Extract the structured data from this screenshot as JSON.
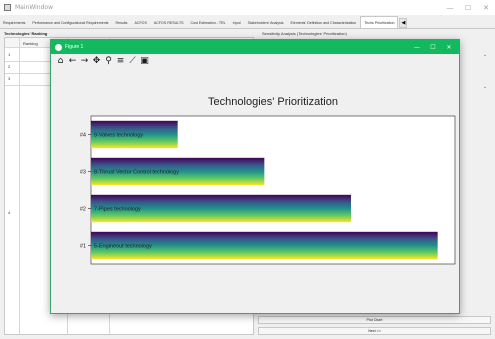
{
  "window": {
    "title": "MainWindow",
    "minimize": "—",
    "maximize": "☐",
    "close": "✕"
  },
  "tabs": [
    {
      "label": "Requirements",
      "active": false
    },
    {
      "label": "Performance and Configurational Requirements",
      "active": false
    },
    {
      "label": "Results",
      "active": false
    },
    {
      "label": "ACFOS",
      "active": false
    },
    {
      "label": "ACFOS RESULTS",
      "active": false
    },
    {
      "label": "Cost Estimation - TRL",
      "active": false
    },
    {
      "label": "Input",
      "active": false
    },
    {
      "label": "Stakeholders' Analysis",
      "active": false
    },
    {
      "label": "Elements' Definition and Characterization",
      "active": false
    },
    {
      "label": "Techs Prioritization",
      "active": true
    }
  ],
  "tab_scroll": "◀",
  "left_panel": {
    "label": "Technologies' Ranking",
    "column_header": "Ranking",
    "rows": [
      "1",
      "2",
      "3",
      "4"
    ]
  },
  "right_panel": {
    "label": "Sensitivity Analysis (Technologies' Prioritization)",
    "combo_arrow": "⌄",
    "plot_chart_button": "Plot Chart",
    "next_button": "Next >>"
  },
  "figure": {
    "title": "Figure 1",
    "minimize": "—",
    "maximize": "☐",
    "close": "✕",
    "toolbar": [
      {
        "name": "home-icon",
        "glyph": "⌂"
      },
      {
        "name": "back-arrow-icon",
        "glyph": "←"
      },
      {
        "name": "forward-arrow-icon",
        "glyph": "→"
      },
      {
        "name": "pan-icon",
        "glyph": "✥"
      },
      {
        "name": "zoom-icon",
        "glyph": "⚲"
      },
      {
        "name": "configure-subplots-icon",
        "glyph": "≡"
      },
      {
        "name": "edit-axis-icon",
        "glyph": "⟋"
      },
      {
        "name": "save-icon",
        "glyph": "▣"
      }
    ]
  },
  "chart_data": {
    "type": "bar",
    "orientation": "horizontal",
    "title": "Technologies' Prioritization",
    "categories": [
      "#1",
      "#2",
      "#3",
      "#4"
    ],
    "labels": [
      "5-Engineout technology",
      "7-Pipes technology",
      "8-Thrust Vector Control technology",
      "9-Valves technology"
    ],
    "values": [
      1.0,
      0.75,
      0.5,
      0.25
    ],
    "xlim": [
      0,
      1.05
    ],
    "grid": false,
    "legend": "none",
    "bar_gradient": [
      "#440154",
      "#3b528b",
      "#21918c",
      "#5ec962",
      "#fde725"
    ]
  }
}
